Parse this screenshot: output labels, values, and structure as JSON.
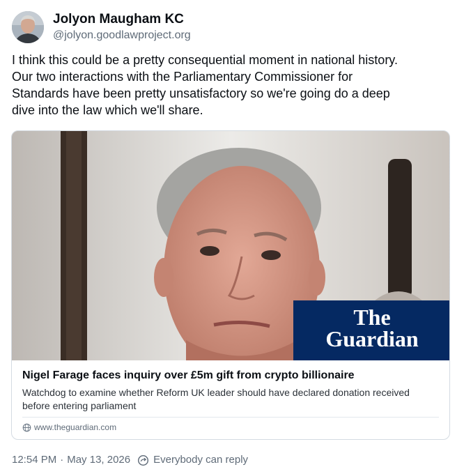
{
  "author": {
    "display_name": "Jolyon Maugham KC",
    "handle": "@jolyon.goodlawproject.org",
    "avatar_icon": "user-avatar"
  },
  "post": {
    "text": "I think this could be a pretty consequential moment in national history.\nOur two interactions with the Parliamentary Commissioner for\nStandards have been pretty unsatisfactory so we're going do a deep\ndive into the law which we'll share."
  },
  "link_card": {
    "image_icon": "article-thumbnail-photo",
    "brand": {
      "line1": "The",
      "line2": "Guardian",
      "color": "#052962"
    },
    "title": "Nigel Farage faces inquiry over £5m gift from crypto billionaire",
    "description": "Watchdog to examine whether Reform UK leader should have declared donation received before entering parliament",
    "domain": "www.theguardian.com",
    "domain_icon": "globe-icon"
  },
  "footer": {
    "time": "12:54 PM",
    "separator": "·",
    "date": "May 13, 2026",
    "reply_icon": "reply-settings-icon",
    "reply_setting": "Everybody can reply"
  }
}
